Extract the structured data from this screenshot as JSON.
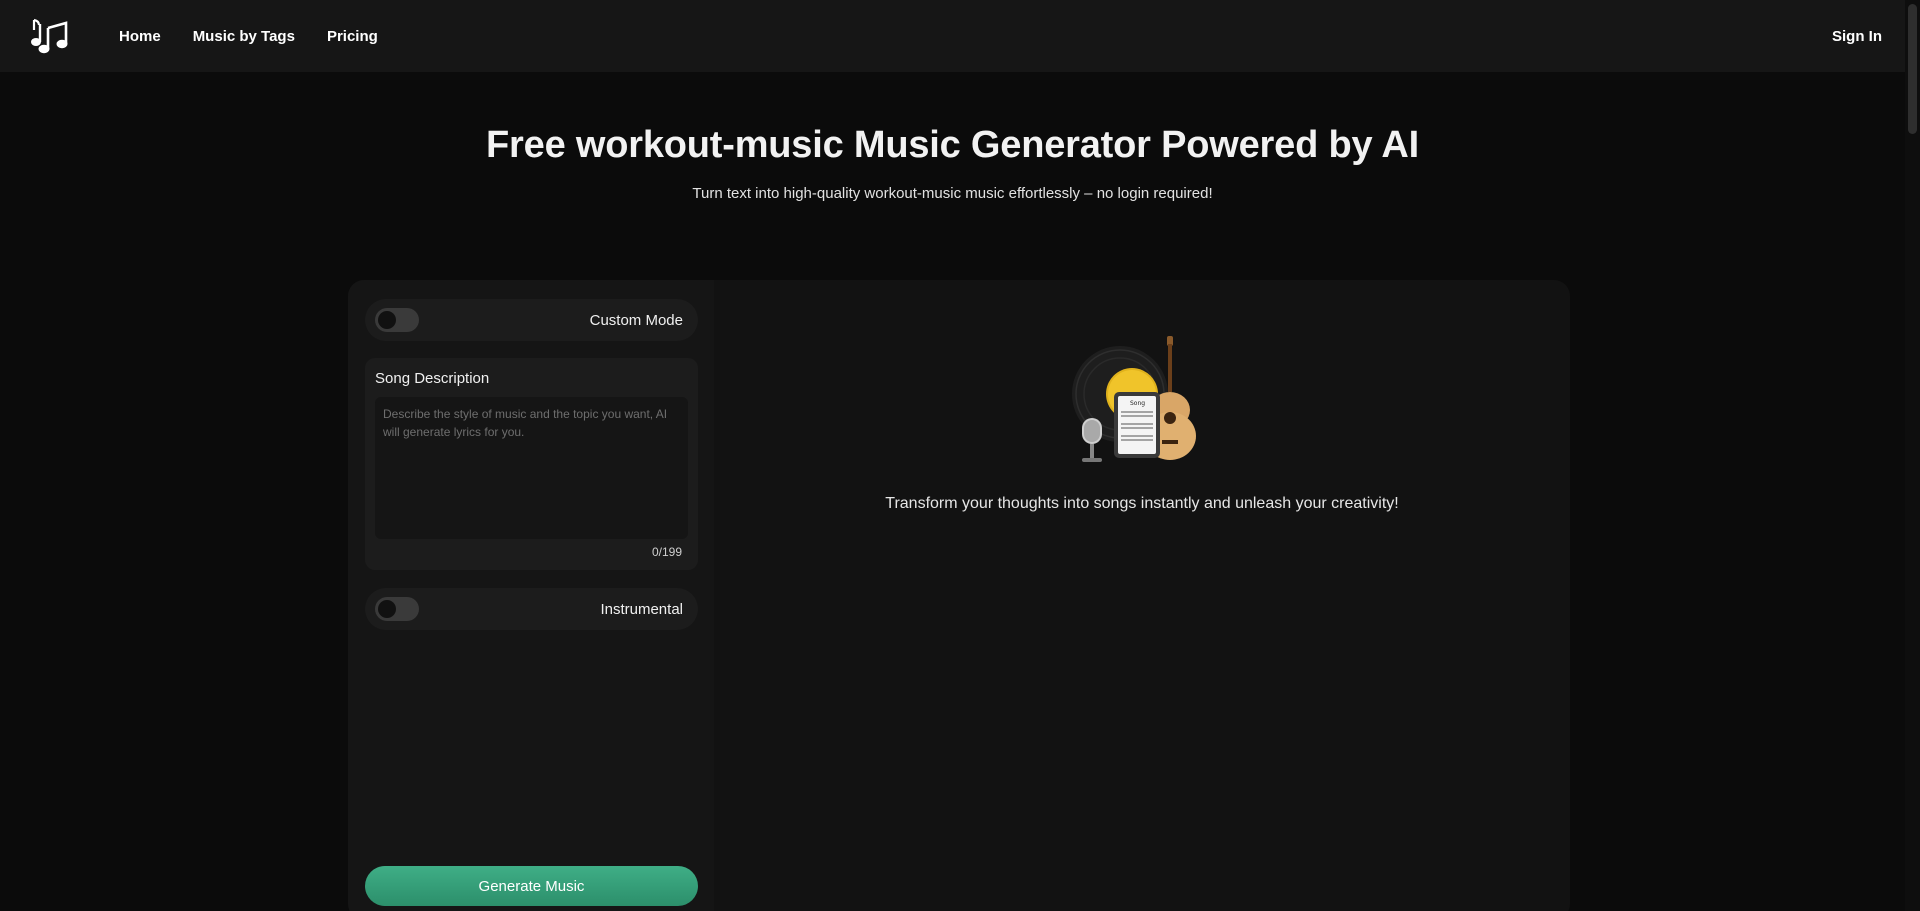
{
  "header": {
    "logo_icon": "music-note-icon",
    "nav": [
      {
        "label": "Home"
      },
      {
        "label": "Music by Tags"
      },
      {
        "label": "Pricing"
      }
    ],
    "signin_label": "Sign In"
  },
  "hero": {
    "title": "Free workout-music Music Generator Powered by AI",
    "subtitle": "Turn text into high-quality workout-music music effortlessly – no login required!"
  },
  "form": {
    "custom_mode_label": "Custom Mode",
    "custom_mode_on": false,
    "description_title": "Song Description",
    "description_placeholder": "Describe the style of music and the topic you want, AI will generate lyrics for you.",
    "description_value": "",
    "char_counter": "0/199",
    "instrumental_label": "Instrumental",
    "instrumental_on": false,
    "generate_label": "Generate Music"
  },
  "result": {
    "illustration_icon": "music-instruments-icon",
    "empty_message": "Transform your thoughts into songs instantly and unleash your creativity!"
  },
  "colors": {
    "background": "#0b0b0b",
    "header": "#161616",
    "accent": "#3fae86"
  }
}
